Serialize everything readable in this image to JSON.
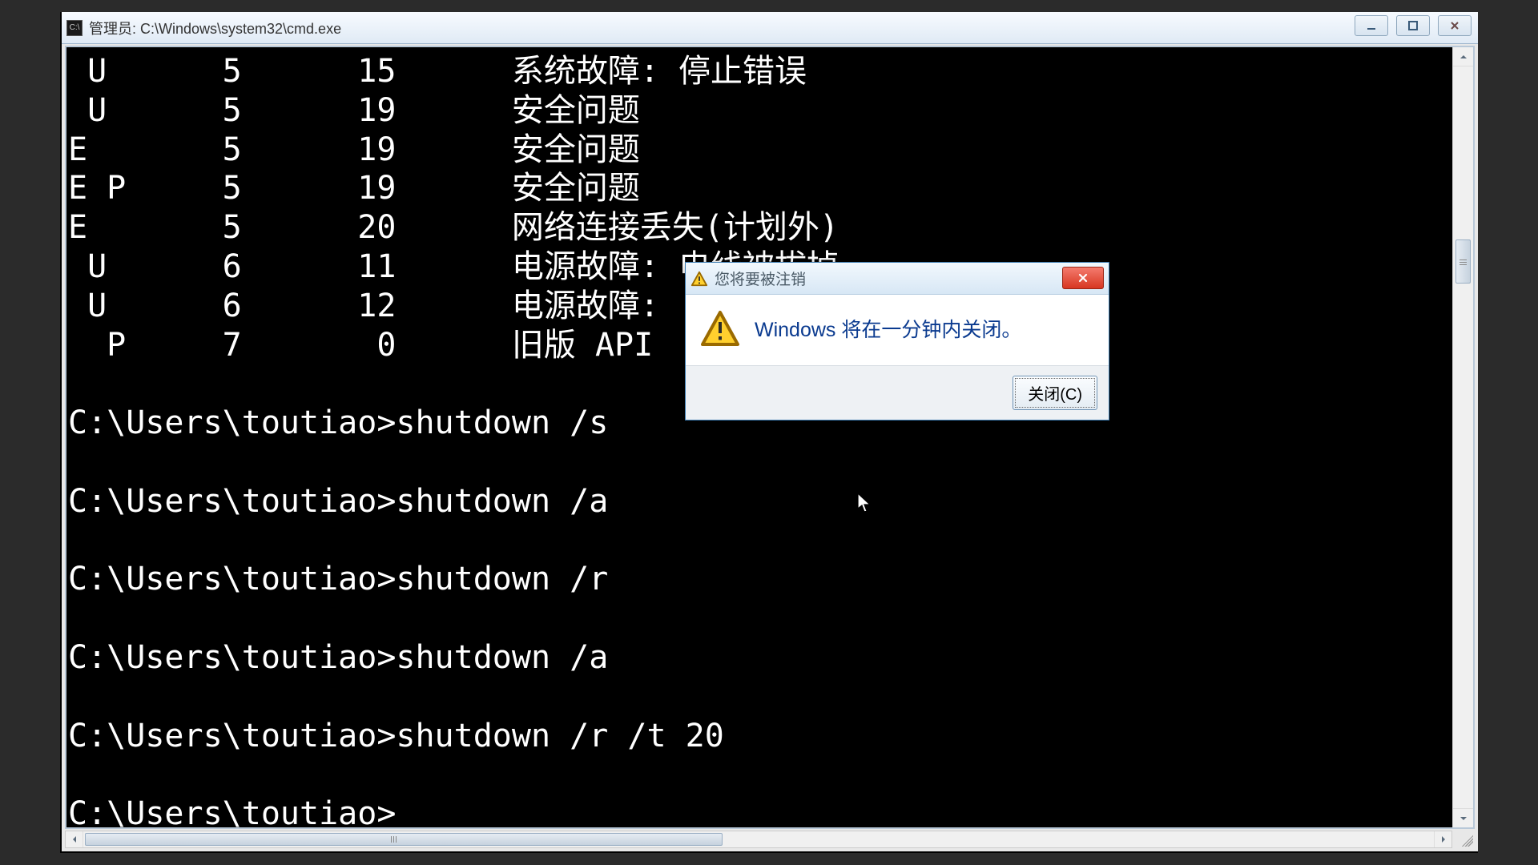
{
  "window": {
    "title": "管理员: C:\\Windows\\system32\\cmd.exe"
  },
  "terminal": {
    "rows": [
      {
        "col1": " U",
        "col2": "5",
        "col3": "15",
        "desc": "系统故障: 停止错误"
      },
      {
        "col1": " U",
        "col2": "5",
        "col3": "19",
        "desc": "安全问题"
      },
      {
        "col1": "E",
        "col2": "5",
        "col3": "19",
        "desc": "安全问题"
      },
      {
        "col1": "E P",
        "col2": "5",
        "col3": "19",
        "desc": "安全问题"
      },
      {
        "col1": "E",
        "col2": "5",
        "col3": "20",
        "desc": "网络连接丢失(计划外)"
      },
      {
        "col1": " U",
        "col2": "6",
        "col3": "11",
        "desc": "电源故障: 电线被拔掉"
      },
      {
        "col1": " U",
        "col2": "6",
        "col3": "12",
        "desc": "电源故障:"
      },
      {
        "col1": "  P",
        "col2": "7",
        "col3": "0",
        "desc": "旧版 API"
      }
    ],
    "prompt": "C:\\Users\\toutiao>",
    "commands": [
      "shutdown /s",
      "shutdown /a",
      "shutdown /r",
      "shutdown /a",
      "shutdown /r /t 20"
    ]
  },
  "dialog": {
    "title": "您将要被注销",
    "message": "Windows 将在一分钟内关闭。",
    "close_btn": "关闭(C)"
  }
}
